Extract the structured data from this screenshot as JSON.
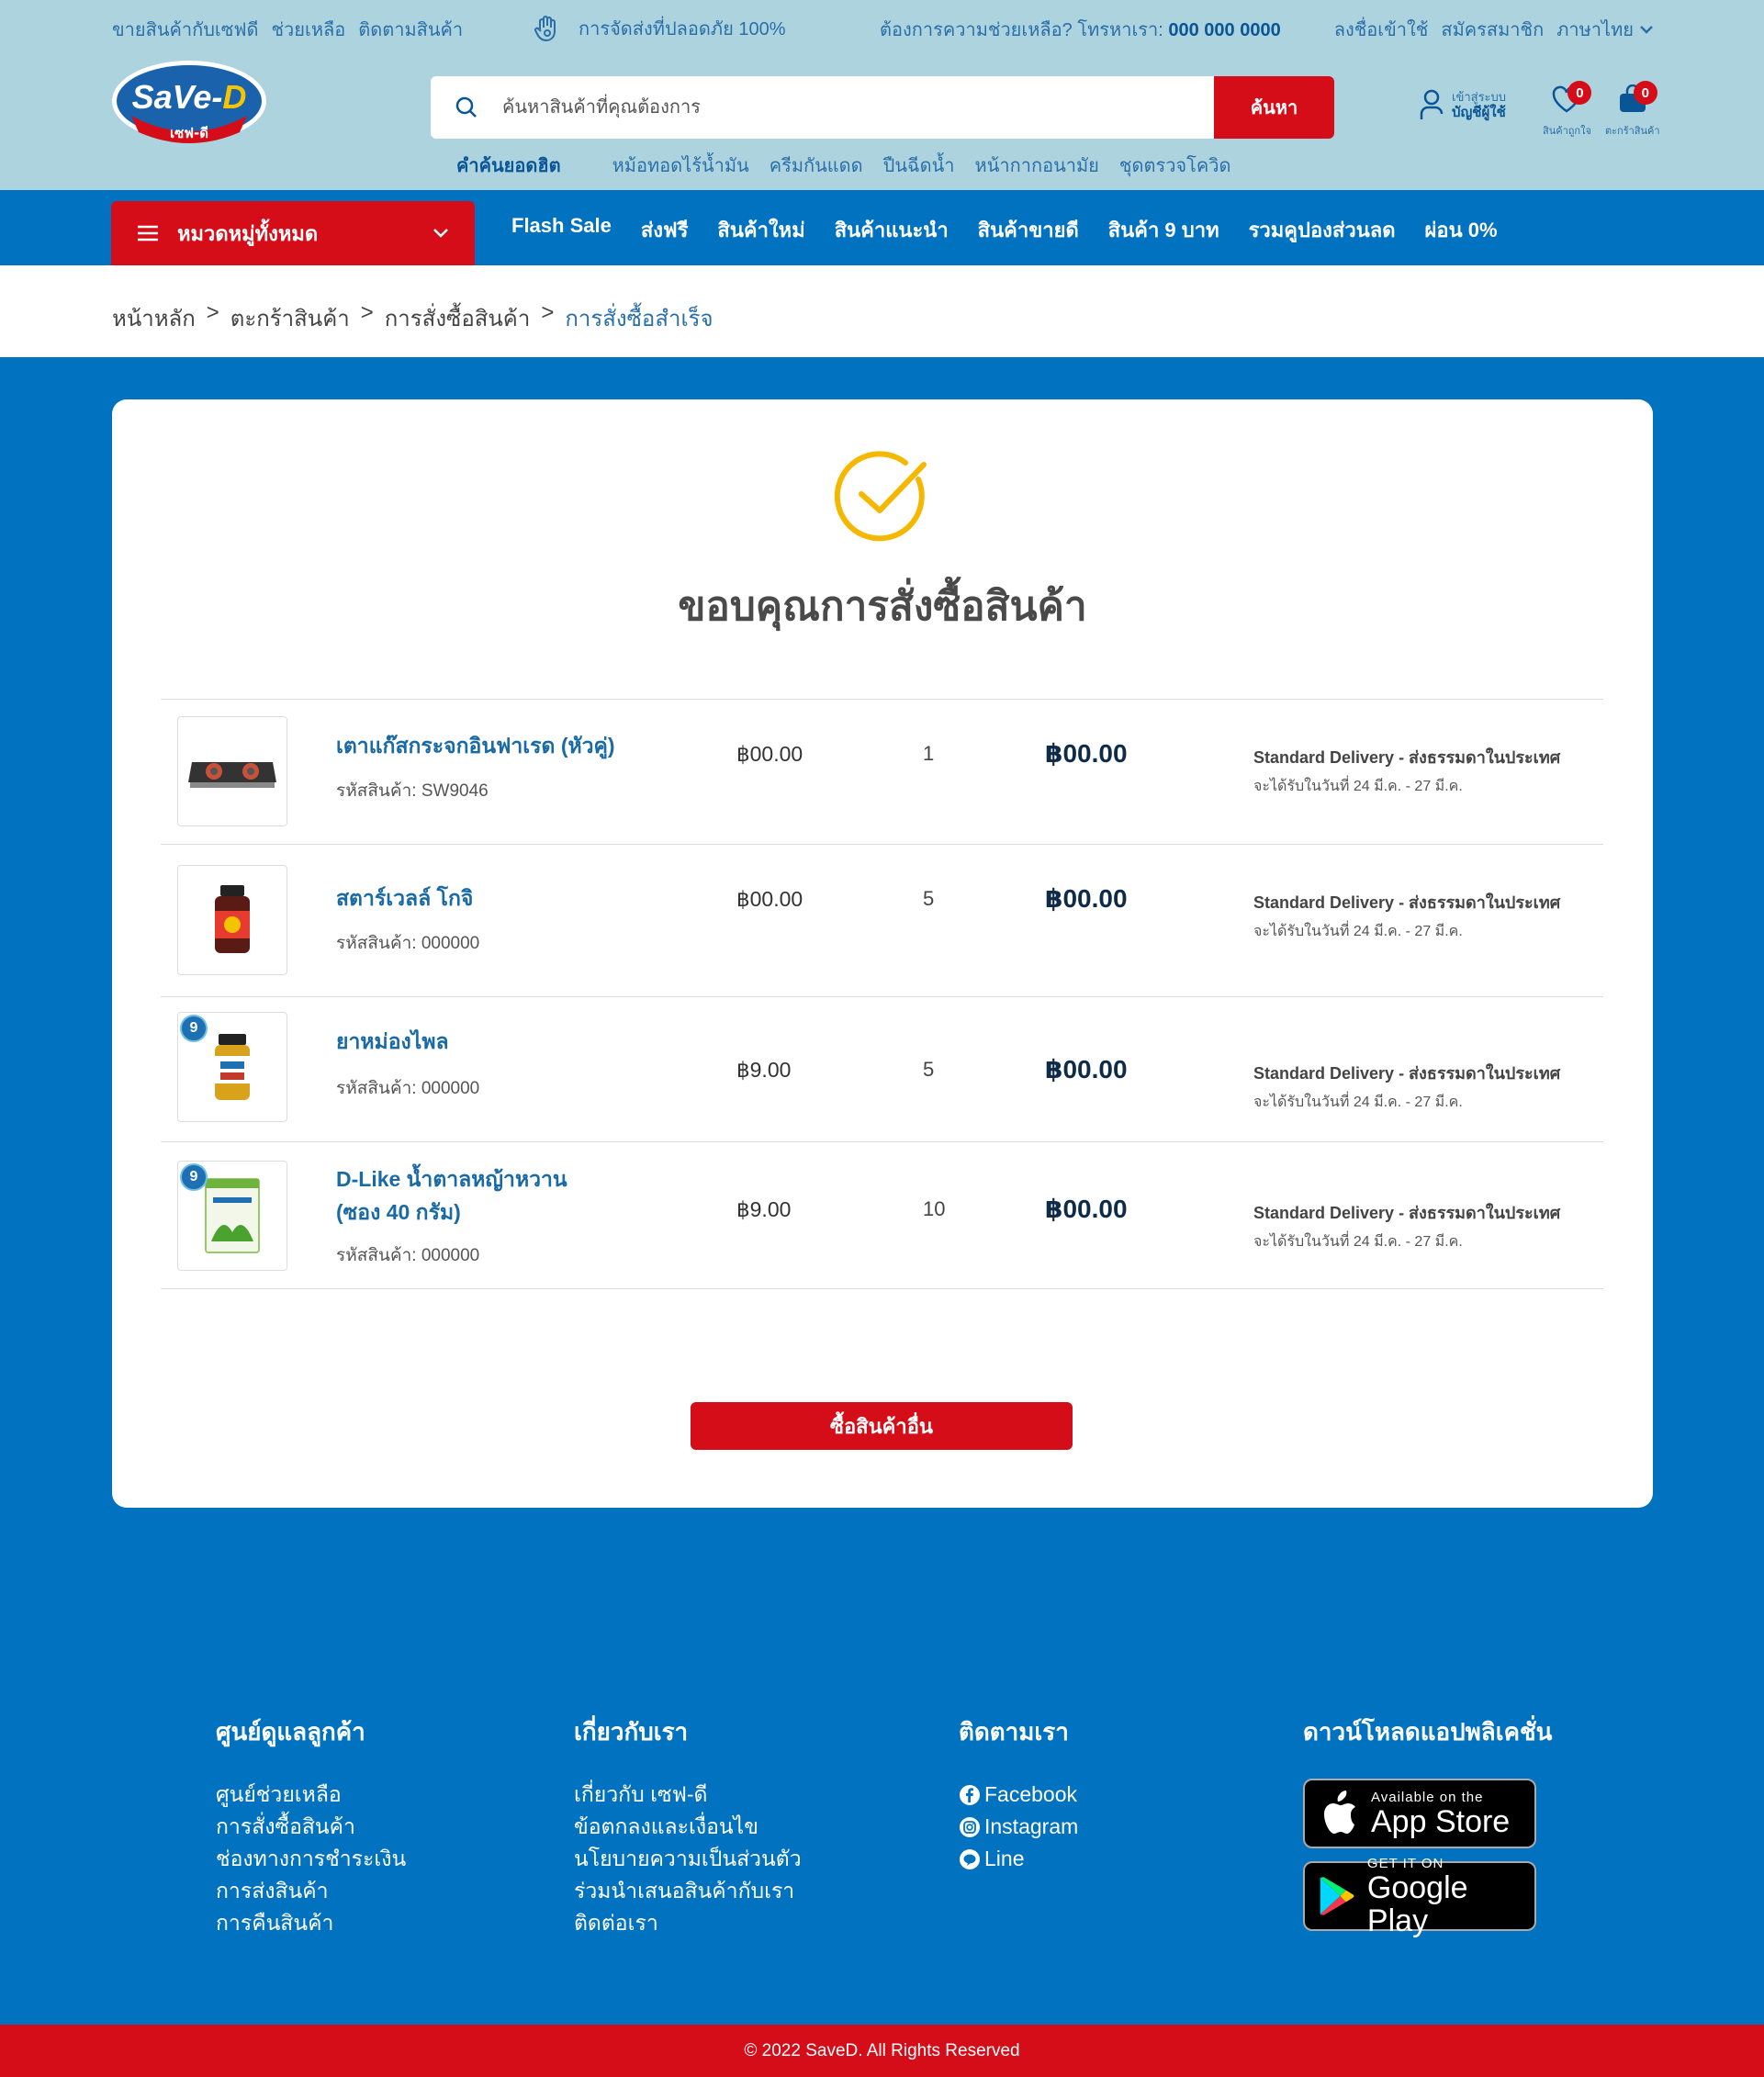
{
  "topbar": {
    "links": [
      "ขายสินค้ากับเซฟดี",
      "ช่วยเหลือ",
      "ติดตามสินค้า"
    ],
    "shipping": "การจัดส่งที่ปลอดภัย 100%",
    "help_text": "ต้องการความช่วยเหลือ? โทรหาเรา:",
    "help_phone": "000 000 0000",
    "login": "ลงชื่อเข้าใช้",
    "register": "สมัครสมาชิก",
    "language": "ภาษาไทย"
  },
  "logo": {
    "brand": "SaVe-D",
    "sub": "เซฟ-ดี"
  },
  "search": {
    "placeholder": "ค้นหาสินค้าที่คุณต้องการ",
    "button": "ค้นหา"
  },
  "hot_keywords": {
    "title": "คำค้นยอดฮิต",
    "items": [
      "หม้อทอดไร้น้ำมัน",
      "ครีมกันแดด",
      "ปืนฉีดน้ำ",
      "หน้ากากอนามัย",
      "ชุดตรวจโควิด"
    ]
  },
  "header_icons": {
    "account_line1": "เข้าสู่ระบบ",
    "account_line2": "บัญชีผู้ใช้",
    "wishlist_caption": "สินค้าถูกใจ",
    "wishlist_count": "0",
    "cart_caption": "ตะกร้าสินค้า",
    "cart_count": "0"
  },
  "nav": {
    "categories_label": "หมวดหมู่ทั้งหมด",
    "links": [
      "Flash Sale",
      "ส่งฟรี",
      "สินค้าใหม่",
      "สินค้าแนะนำ",
      "สินค้าขายดี",
      "สินค้า 9 บาท",
      "รวมคูปองส่วนลด",
      "ผ่อน 0%"
    ]
  },
  "breadcrumb": [
    "หน้าหลัก",
    "ตะกร้าสินค้า",
    "การสั่งซื้อสินค้า",
    "การสั่งซื้อสำเร็จ"
  ],
  "order": {
    "title": "ขอบคุณการสั่งซื้อสินค้า",
    "items": [
      {
        "name_lines": [
          "เตาแก๊สกระจกอินฟาเรด (หัวคู่)"
        ],
        "sku": "รหัสสินค้า: SW9046",
        "price": "฿00.00",
        "qty": "1",
        "total": "฿00.00",
        "shipping": "Standard Delivery - ส่งธรรมดาในประเทศ",
        "eta": "จะได้รับในวันที่ 24 มี.ค. - 27 มี.ค.",
        "badge": ""
      },
      {
        "name_lines": [
          "สตาร์เวลล์ โกจิ"
        ],
        "sku": "รหัสสินค้า: 000000",
        "price": "฿00.00",
        "qty": "5",
        "total": "฿00.00",
        "shipping": "Standard Delivery - ส่งธรรมดาในประเทศ",
        "eta": "จะได้รับในวันที่ 24 มี.ค. - 27 มี.ค.",
        "badge": ""
      },
      {
        "name_lines": [
          "ยาหม่องไพล"
        ],
        "sku": "รหัสสินค้า: 000000",
        "price": "฿9.00",
        "qty": "5",
        "total": "฿00.00",
        "shipping": "Standard Delivery - ส่งธรรมดาในประเทศ",
        "eta": "จะได้รับในวันที่ 24 มี.ค. - 27 มี.ค.",
        "badge": "9"
      },
      {
        "name_lines": [
          "D-Like น้ำตาลหญ้าหวาน",
          "(ซอง 40 กรัม)"
        ],
        "sku": "รหัสสินค้า: 000000",
        "price": "฿9.00",
        "qty": "10",
        "total": "฿00.00",
        "shipping": "Standard Delivery - ส่งธรรมดาในประเทศ",
        "eta": "จะได้รับในวันที่ 24 มี.ค. - 27 มี.ค.",
        "badge": "9"
      }
    ],
    "continue_button": "ซื้อสินค้าอื่น"
  },
  "footer": {
    "customer_title": "ศูนย์ดูแลลูกค้า",
    "customer_links": [
      "ศูนย์ช่วยเหลือ",
      "การสั่งซื้อสินค้า",
      "ช่องทางการชำระเงิน",
      "การส่งสินค้า",
      "การคืนสินค้า"
    ],
    "about_title": "เกี่ยวกับเรา",
    "about_links": [
      "เกี่ยวกับ เซฟ-ดี",
      "ข้อตกลงและเงื่อนไข",
      "นโยบายความเป็นส่วนตัว",
      "ร่วมนำเสนอสินค้ากับเรา",
      "ติดต่อเรา"
    ],
    "follow_title": "ติดตามเรา",
    "follow_links": [
      "Facebook",
      "Instagram",
      "Line"
    ],
    "app_title": "ดาวน์โหลดแอปพลิเคชั่น",
    "appstore_small": "Available on the",
    "appstore_big": "App Store",
    "googleplay_small": "GET IT ON",
    "googleplay_big": "Google Play"
  },
  "copyright": "© 2022 SaveD. All Rights Reserved",
  "colors": {
    "brand_blue": "#0072c0",
    "brand_red": "#d40d19",
    "topbar": "#add3df",
    "check_yellow": "#f5b800"
  }
}
